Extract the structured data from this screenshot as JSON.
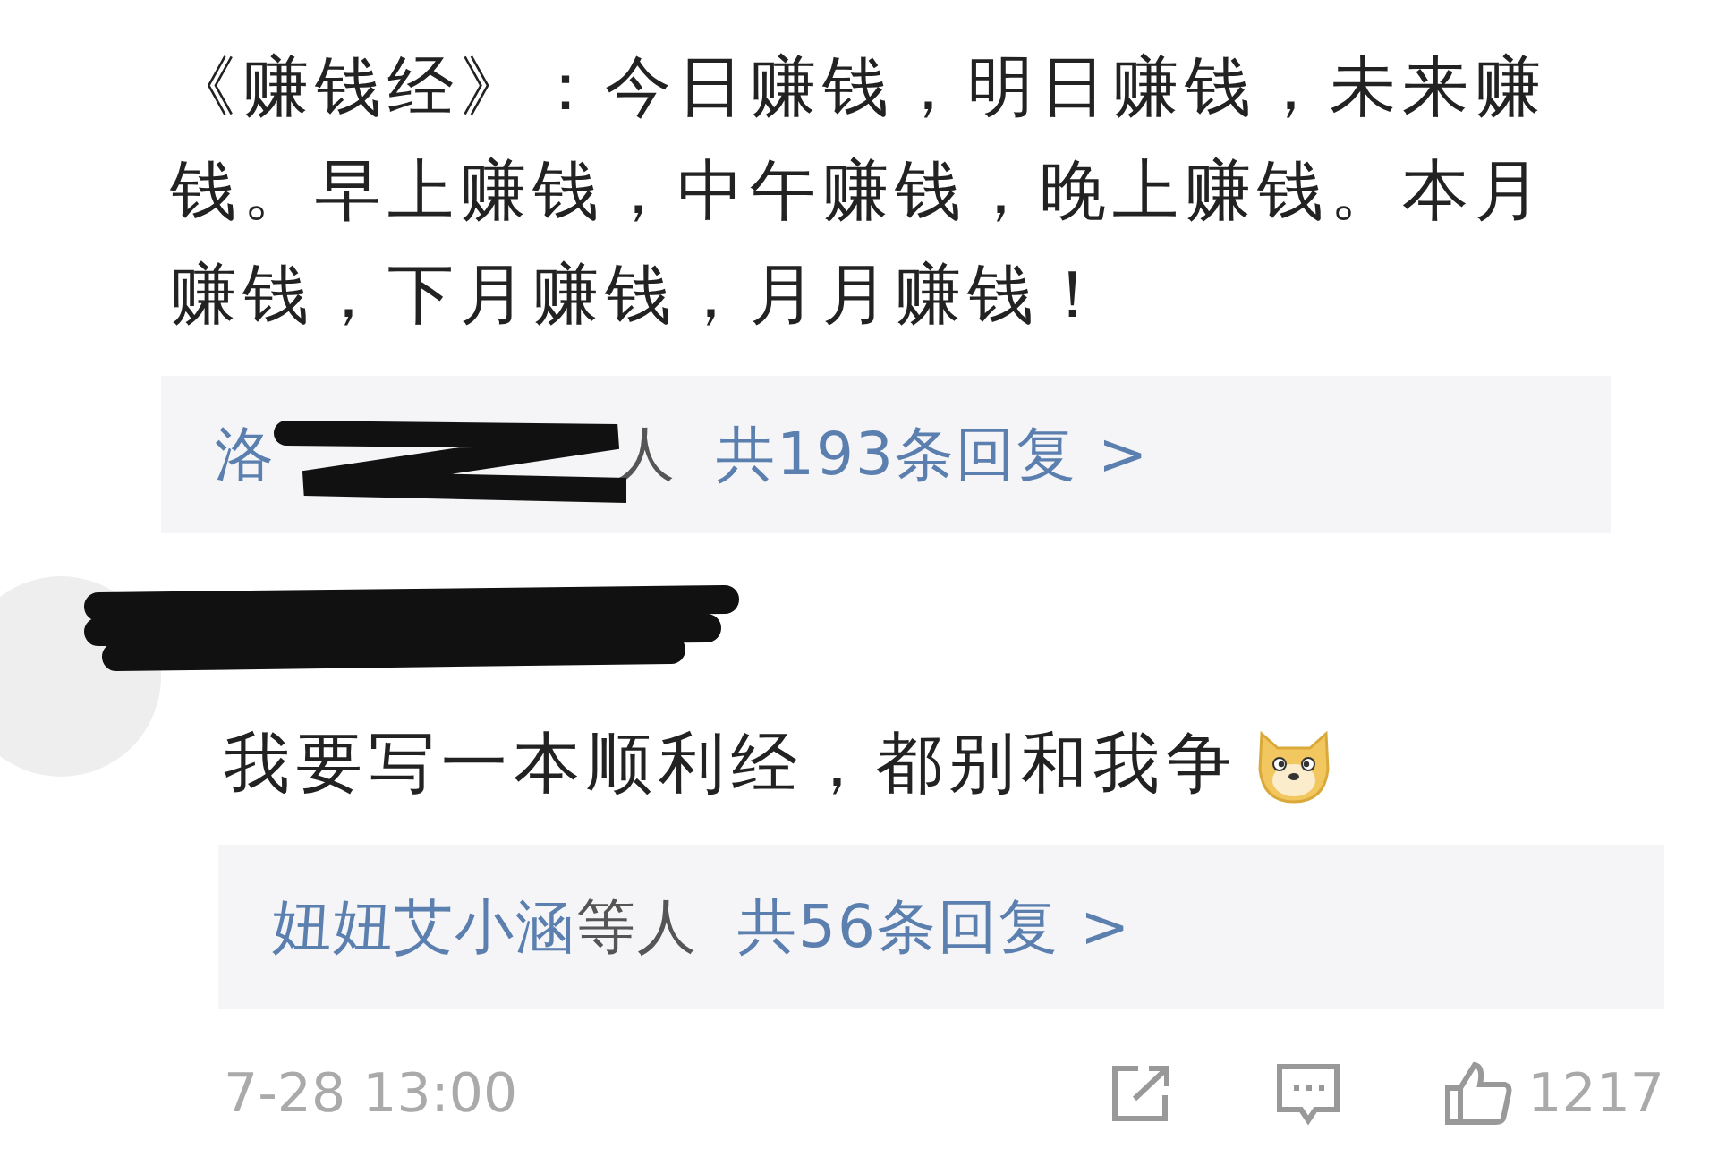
{
  "comments": [
    {
      "text": "《赚钱经》：今日赚钱，明日赚钱，未来赚钱。早上赚钱，中午赚钱，晚上赚钱。本月赚钱，下月赚钱，月月赚钱！",
      "replies": {
        "name": "洛",
        "suffix": "人",
        "count": "共193条回复 >"
      }
    },
    {
      "text": "我要写一本顺利经，都别和我争",
      "replies": {
        "name": "妞妞艾小涵",
        "suffix": "等人",
        "count": "共56条回复 >"
      },
      "time": "7-28 13:00",
      "likes": "1217"
    }
  ]
}
